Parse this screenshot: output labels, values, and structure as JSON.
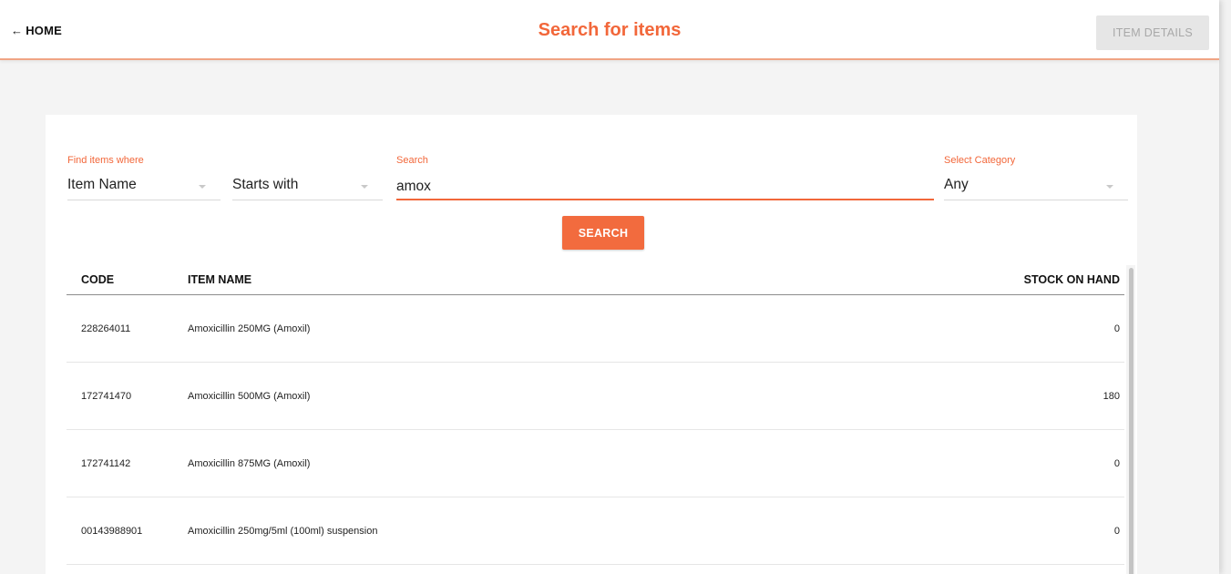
{
  "header": {
    "home_label": "HOME",
    "title": "Search for items",
    "details_label": "ITEM DETAILS"
  },
  "filters": {
    "find_label": "Find items where",
    "field_value": "Item Name",
    "condition_value": "Starts with",
    "search_label": "Search",
    "search_value": "amox",
    "category_label": "Select Category",
    "category_value": "Any"
  },
  "search_button": "SEARCH",
  "table": {
    "columns": [
      "CODE",
      "ITEM NAME",
      "STOCK ON HAND"
    ],
    "rows": [
      {
        "code": "228264011",
        "name": "Amoxicillin 250MG (Amoxil)",
        "stock": "0"
      },
      {
        "code": "172741470",
        "name": "Amoxicillin 500MG (Amoxil)",
        "stock": "180"
      },
      {
        "code": "172741142",
        "name": "Amoxicillin 875MG (Amoxil)",
        "stock": "0"
      },
      {
        "code": "00143988901",
        "name": "Amoxicillin 250mg/5ml (100ml) suspension",
        "stock": "0"
      }
    ]
  },
  "colors": {
    "accent": "#f2673a",
    "button": "#f26b3e"
  }
}
